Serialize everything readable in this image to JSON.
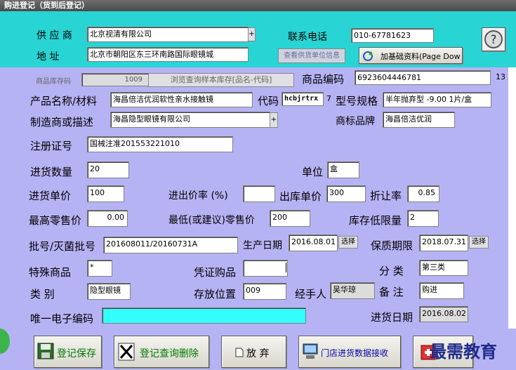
{
  "window": {
    "title": "购进登记（货到后登记）"
  },
  "supplier": {
    "label": "供 应 商",
    "value": "北京视清有限公司",
    "expand": "+",
    "address_label": "地  址",
    "address_value": "北京市朝阳区东三环南路国际眼镜城",
    "phone_label": "联系电话",
    "phone_value": "010-67781623",
    "view_supplier_btn": "查看供货单位信息",
    "add_basic_btn": "加基础资料(Page Dow"
  },
  "product": {
    "stock_code_label": "商品库存码",
    "stock_code_value": "1009",
    "browse_btn": "浏览查询样本库存[品名-代码]",
    "code_label": "商品编码",
    "code_value": "6923604446781",
    "code_len": "13",
    "name_label": "产品名称/材料",
    "name_value": "海昌倍洁优润软性亲水接触镜",
    "alias_label": "代码",
    "alias_value": "hcbjrtrx",
    "alias_len": "7",
    "spec_label": "型号规格",
    "spec_value": "半年抛弃型 -9.00 1片/盒",
    "maker_label": "制造商或描述",
    "maker_value": "海昌隐型眼镜有限公司",
    "maker_expand": "+",
    "brand_label": "商标品牌",
    "brand_value": "海昌倍洁优润",
    "reg_label": "注册证号",
    "reg_value": "国械注准201553221010"
  },
  "purchase": {
    "qty_label": "进货数量",
    "qty_value": "20",
    "unit_label": "单位",
    "unit_value": "盒",
    "price_label": "进货单价",
    "price_value": "100",
    "markup_label": "进出价率 (%)",
    "markup_value": "",
    "out_price_label": "出库单价",
    "out_price_value": "300",
    "discount_label": "折让率",
    "discount_value": "0.85",
    "max_retail_label": "最高零售价",
    "max_retail_value": "0.00",
    "min_retail_label": "最低(或建议)零售价",
    "min_retail_value": "200",
    "min_stock_label": "库存低限量",
    "min_stock_value": "2",
    "batch_label": "批号/灭菌批号",
    "batch_value": "201608011/20160731A",
    "prod_date_label": "生产日期",
    "prod_date_value": "2016.08.01",
    "select_btn": "选择",
    "expiry_label": "保质期限",
    "expiry_value": "2018.07.31",
    "special_label": "特殊商品",
    "special_value": "*",
    "voucher_label": "凭证购品",
    "voucher_value": "",
    "class_label": "分  类",
    "class_value": "第三类",
    "category_label": "类  别",
    "category_value": "隐型眼镜",
    "location_label": "存放位置",
    "location_value": "009",
    "handler_label": "经手人",
    "handler_value": "吴华琼",
    "note_label": "备  注",
    "note_value": "购进",
    "uid_label": "唯一电子编码",
    "uid_value": "",
    "in_date_label": "进货日期",
    "in_date_value": "2016.08.02"
  },
  "toolbar": {
    "save": "登记保存",
    "query_delete": "登记查询删除",
    "abandon": "放 弃",
    "receive": "门店进货数据接收"
  },
  "watermark": "最需教育",
  "colors": {
    "top_bg": "#29d4d4",
    "main_bg": "#b6b3f4",
    "uid_field": "#33ffff"
  }
}
